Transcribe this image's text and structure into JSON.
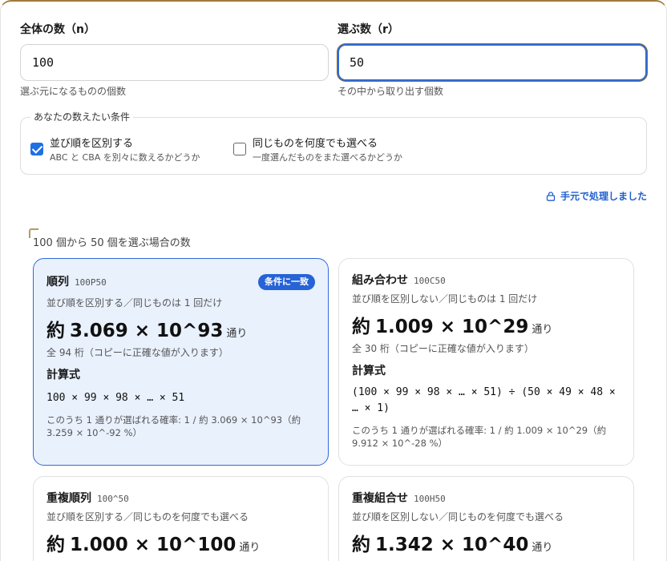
{
  "n_field": {
    "label": "全体の数（n）",
    "value": "100",
    "hint": "選ぶ元になるものの個数"
  },
  "r_field": {
    "label": "選ぶ数（r）",
    "value": "50",
    "hint": "その中から取り出す個数"
  },
  "conditions": {
    "legend": "あなたの数えたい条件",
    "order": {
      "title": "並び順を区別する",
      "desc": "ABC と CBA を別々に数えるかどうか",
      "checked": true
    },
    "repeat": {
      "title": "同じものを何度でも選べる",
      "desc": "一度選んだものをまた選べるかどうか",
      "checked": false
    }
  },
  "local_note": {
    "text": "手元で処理しました",
    "icon": "lock-icon"
  },
  "results": {
    "title": "100 個から 50 個を選ぶ場合の数",
    "cards": [
      {
        "name": "順列",
        "notation": "100P50",
        "badge": "条件に一致",
        "desc": "並び順を区別する／同じものは 1 回だけ",
        "approx": "約",
        "value": "3.069 × 10^93",
        "unit": "通り",
        "digits": "全 94 桁（コピーに正確な値が入ります）",
        "formula_label": "計算式",
        "formula": "100 × 99 × 98 × … × 51",
        "prob": "このうち 1 通りが選ばれる確率: 1 / 約 3.069 × 10^93（約 3.259 × 10^-92 %）"
      },
      {
        "name": "組み合わせ",
        "notation": "100C50",
        "desc": "並び順を区別しない／同じものは 1 回だけ",
        "approx": "約",
        "value": "1.009 × 10^29",
        "unit": "通り",
        "digits": "全 30 桁（コピーに正確な値が入ります）",
        "formula_label": "計算式",
        "formula": "(100 × 99 × 98 × … × 51) ÷ (50 × 49 × 48 × … × 1)",
        "prob": "このうち 1 通りが選ばれる確率: 1 / 約 1.009 × 10^29（約 9.912 × 10^-28 %）"
      },
      {
        "name": "重複順列",
        "notation": "100^50",
        "desc": "並び順を区別する／同じものを何度でも選べる",
        "approx": "約",
        "value": "1.000 × 10^100",
        "unit": "通り"
      },
      {
        "name": "重複組合せ",
        "notation": "100H50",
        "desc": "並び順を区別しない／同じものを何度でも選べる",
        "approx": "約",
        "value": "1.342 × 10^40",
        "unit": "通り"
      }
    ]
  },
  "colors": {
    "accent": "#2563d6",
    "match_bg": "#e9f1fd",
    "frame": "#a07a3c"
  }
}
